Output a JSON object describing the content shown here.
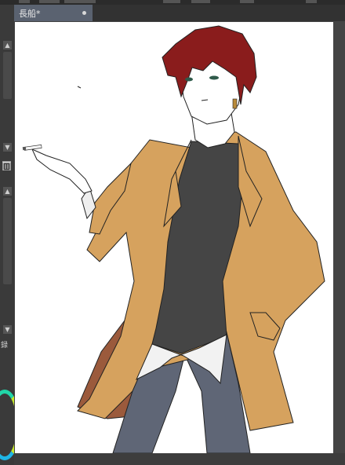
{
  "document": {
    "tab_title": "長船*",
    "unsaved_indicator": "●"
  },
  "left_panel": {
    "label_fragment": "録"
  },
  "icons": {
    "trash": "trash-icon",
    "scroll_up": "chevron-up-icon",
    "scroll_down": "chevron-down-icon",
    "color_wheel": "color-wheel-icon"
  },
  "colors": {
    "tab_active": "#5a6270",
    "canvas_bg": "#424242",
    "paper": "#ffffff",
    "hair": "#8a1c1c",
    "coat": "#d6a25e",
    "coat_lining": "#9b5a3c",
    "shirt": "#454545",
    "pants": "#5f6676"
  }
}
